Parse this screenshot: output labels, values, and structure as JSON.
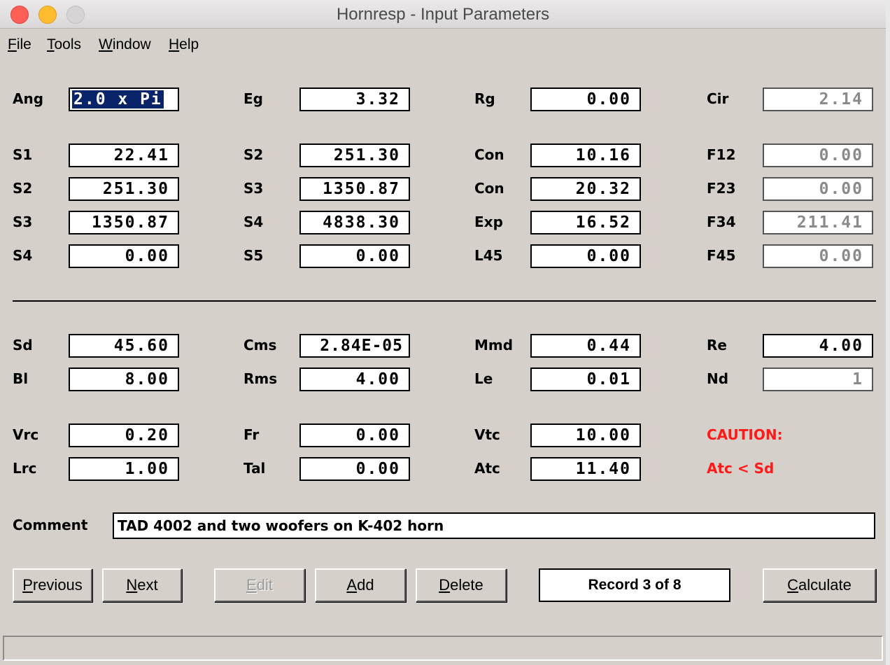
{
  "window": {
    "title": "Hornresp - Input Parameters"
  },
  "menu": [
    {
      "label": "File",
      "accel": "F",
      "rest": "ile"
    },
    {
      "label": "Tools",
      "accel": "T",
      "rest": "ools"
    },
    {
      "label": "Window",
      "accel": "W",
      "rest": "indow"
    },
    {
      "label": "Help",
      "accel": "H",
      "rest": "elp"
    }
  ],
  "params": {
    "row1": [
      {
        "label": "Ang",
        "value": "2.0 x Pi"
      },
      {
        "label": "Eg",
        "value": "3.32"
      },
      {
        "label": "Rg",
        "value": "0.00"
      },
      {
        "label": "Cir",
        "value": "2.14"
      }
    ],
    "horn": [
      [
        {
          "label": "S1",
          "value": "22.41"
        },
        {
          "label": "S2",
          "value": "251.30"
        },
        {
          "label": "Con",
          "value": "10.16"
        },
        {
          "label": "F12",
          "value": "0.00"
        }
      ],
      [
        {
          "label": "S2",
          "value": "251.30"
        },
        {
          "label": "S3",
          "value": "1350.87"
        },
        {
          "label": "Con",
          "value": "20.32"
        },
        {
          "label": "F23",
          "value": "0.00"
        }
      ],
      [
        {
          "label": "S3",
          "value": "1350.87"
        },
        {
          "label": "S4",
          "value": "4838.30"
        },
        {
          "label": "Exp",
          "value": "16.52"
        },
        {
          "label": "F34",
          "value": "211.41"
        }
      ],
      [
        {
          "label": "S4",
          "value": "0.00"
        },
        {
          "label": "S5",
          "value": "0.00"
        },
        {
          "label": "L45",
          "value": "0.00"
        },
        {
          "label": "F45",
          "value": "0.00"
        }
      ]
    ],
    "driver": [
      [
        {
          "label": "Sd",
          "value": "45.60"
        },
        {
          "label": "Cms",
          "value": "2.84E-05"
        },
        {
          "label": "Mmd",
          "value": "0.44"
        },
        {
          "label": "Re",
          "value": "4.00"
        }
      ],
      [
        {
          "label": "Bl",
          "value": "8.00"
        },
        {
          "label": "Rms",
          "value": "4.00"
        },
        {
          "label": "Le",
          "value": "0.01"
        },
        {
          "label": "Nd",
          "value": "1"
        }
      ]
    ],
    "chamber": [
      [
        {
          "label": "Vrc",
          "value": "0.20"
        },
        {
          "label": "Fr",
          "value": "0.00"
        },
        {
          "label": "Vtc",
          "value": "10.00"
        }
      ],
      [
        {
          "label": "Lrc",
          "value": "1.00"
        },
        {
          "label": "Tal",
          "value": "0.00"
        },
        {
          "label": "Atc",
          "value": "11.40"
        }
      ]
    ]
  },
  "caution": {
    "title": "CAUTION:",
    "message": "Atc < Sd",
    "color": "#ff1a1a"
  },
  "comment": {
    "label": "Comment",
    "value": "TAD 4002 and two woofers on K-402 horn"
  },
  "buttons": {
    "previous": {
      "label": "Previous",
      "accel": "P",
      "rest": "revious"
    },
    "next": {
      "label": "Next",
      "accel": "N",
      "rest": "ext"
    },
    "edit": {
      "label": "Edit",
      "accel": "E",
      "rest": "dit",
      "enabled": false
    },
    "add": {
      "label": "Add",
      "accel": "A",
      "rest": "dd"
    },
    "delete": {
      "label": "Delete",
      "accel": "D",
      "rest": "elete"
    },
    "calculate": {
      "label": "Calculate",
      "accel": "C",
      "rest": "alculate"
    }
  },
  "record": "Record 3 of 8"
}
